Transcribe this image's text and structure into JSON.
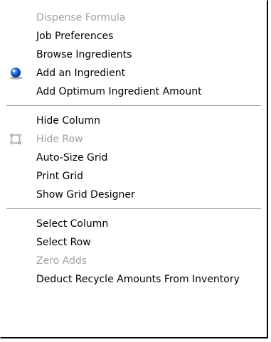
{
  "menu": {
    "groups": [
      {
        "items": [
          {
            "label": "Dispense Formula",
            "enabled": false,
            "icon": null
          },
          {
            "label": "Job Preferences",
            "enabled": true,
            "icon": null
          },
          {
            "label": "Browse Ingredients",
            "enabled": true,
            "icon": null
          },
          {
            "label": "Add an Ingredient",
            "enabled": true,
            "icon": "blue-sphere-icon"
          },
          {
            "label": "Add Optimum Ingredient Amount",
            "enabled": true,
            "icon": null
          }
        ]
      },
      {
        "items": [
          {
            "label": "Hide Column",
            "enabled": true,
            "icon": null
          },
          {
            "label": "Hide Row",
            "enabled": false,
            "icon": "hide-row-icon"
          },
          {
            "label": "Auto-Size Grid",
            "enabled": true,
            "icon": null
          },
          {
            "label": "Print Grid",
            "enabled": true,
            "icon": null
          },
          {
            "label": "Show Grid Designer",
            "enabled": true,
            "icon": null
          }
        ]
      },
      {
        "items": [
          {
            "label": "Select Column",
            "enabled": true,
            "icon": null
          },
          {
            "label": "Select Row",
            "enabled": true,
            "icon": null
          },
          {
            "label": "Zero Adds",
            "enabled": false,
            "icon": null
          },
          {
            "label": "Deduct Recycle Amounts From Inventory",
            "enabled": true,
            "icon": null
          }
        ]
      }
    ]
  },
  "colors": {
    "text": "#000000",
    "disabled_text": "#a0a0a0",
    "separator": "#a0a0a0",
    "menu_border": "#000000"
  }
}
